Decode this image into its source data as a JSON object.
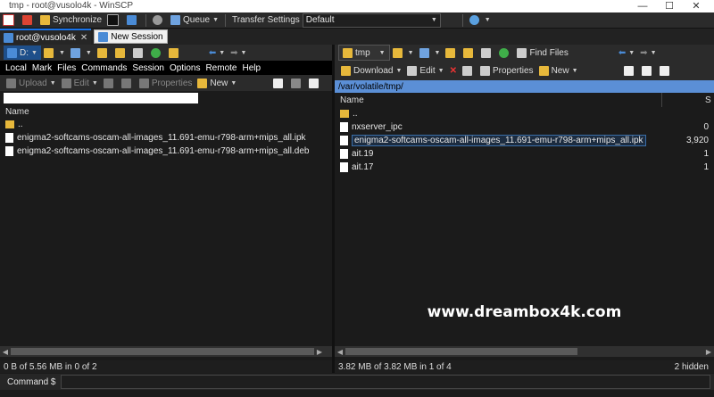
{
  "window": {
    "title": "tmp - root@vusolo4k - WinSCP",
    "minimize": "—",
    "maximize": "☐",
    "close": "✕"
  },
  "toolbar": {
    "synchronize": "Synchronize",
    "queue": "Queue",
    "transfer_settings_label": "Transfer Settings",
    "transfer_settings_value": "Default"
  },
  "tabs": [
    {
      "label": "root@vusolo4k",
      "close": "✕"
    },
    {
      "label": "New Session"
    }
  ],
  "left": {
    "drive": "D:",
    "menu": [
      "Local",
      "Mark",
      "Files",
      "Commands",
      "Session",
      "Options",
      "Remote",
      "Help"
    ],
    "actions": {
      "upload": "Upload",
      "edit": "Edit",
      "properties": "Properties",
      "new": "New"
    },
    "columns": {
      "name": "Name"
    },
    "files": [
      {
        "name": "..",
        "type": "up"
      },
      {
        "name": "enigma2-softcams-oscam-all-images_11.691-emu-r798-arm+mips_all.ipk",
        "type": "file"
      },
      {
        "name": "enigma2-softcams-oscam-all-images_11.691-emu-r798-arm+mips_all.deb",
        "type": "file"
      }
    ],
    "status": "0 B of 5.56 MB in 0 of 2"
  },
  "right": {
    "dir": "tmp",
    "find_files": "Find Files",
    "actions": {
      "download": "Download",
      "edit": "Edit",
      "properties": "Properties",
      "new": "New"
    },
    "path": "/var/volatile/tmp/",
    "columns": {
      "name": "Name",
      "size": "S"
    },
    "files": [
      {
        "name": "..",
        "size": "",
        "type": "up"
      },
      {
        "name": "nxserver_ipc",
        "size": "0",
        "type": "file"
      },
      {
        "name": "enigma2-softcams-oscam-all-images_11.691-emu-r798-arm+mips_all.ipk",
        "size": "3,920",
        "type": "file",
        "selected": true
      },
      {
        "name": "ait.19",
        "size": "1",
        "type": "file"
      },
      {
        "name": "ait.17",
        "size": "1",
        "type": "file"
      }
    ],
    "status": "3.82 MB of 3.82 MB in 1 of 4",
    "status_hidden": "2 hidden"
  },
  "watermark": "www.dreambox4k.com",
  "command": {
    "label": "Command $"
  },
  "colors": {
    "accent": "#1a73e8",
    "path_bg": "#5b8fd6",
    "folder": "#e7b83b"
  }
}
